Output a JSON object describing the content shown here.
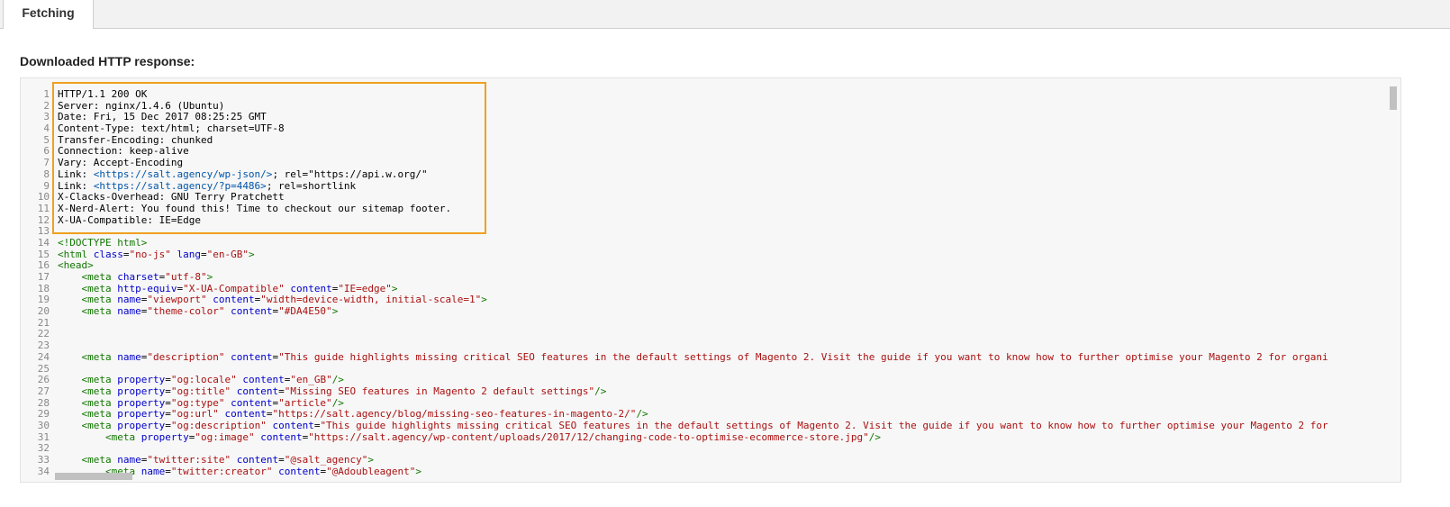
{
  "tabs": [
    {
      "label": "Fetching",
      "active": true
    }
  ],
  "section": {
    "heading": "Downloaded HTTP response:"
  },
  "colors": {
    "highlight_border": "#f0a020",
    "tag": "#117700",
    "attribute": "#0000cc",
    "string": "#aa1111",
    "link": "#0055aa"
  },
  "code_lines": [
    {
      "n": "1",
      "segments": [
        {
          "t": "HTTP/1.1 200 OK",
          "c": ""
        }
      ]
    },
    {
      "n": "2",
      "segments": [
        {
          "t": "Server: nginx/1.4.6 (Ubuntu)",
          "c": ""
        }
      ]
    },
    {
      "n": "3",
      "segments": [
        {
          "t": "Date: Fri, 15 Dec 2017 08:25:25 GMT",
          "c": ""
        }
      ]
    },
    {
      "n": "4",
      "segments": [
        {
          "t": "Content-Type: text/html; charset=UTF-8",
          "c": ""
        }
      ]
    },
    {
      "n": "5",
      "segments": [
        {
          "t": "Transfer-Encoding: chunked",
          "c": ""
        }
      ]
    },
    {
      "n": "6",
      "segments": [
        {
          "t": "Connection: keep-alive",
          "c": ""
        }
      ]
    },
    {
      "n": "7",
      "segments": [
        {
          "t": "Vary: Accept-Encoding",
          "c": ""
        }
      ]
    },
    {
      "n": "8",
      "segments": [
        {
          "t": "Link: ",
          "c": ""
        },
        {
          "t": "<https://salt.agency/wp-json/>",
          "c": "link"
        },
        {
          "t": "; rel=\"https://api.w.org/\"",
          "c": ""
        }
      ]
    },
    {
      "n": "9",
      "segments": [
        {
          "t": "Link: ",
          "c": ""
        },
        {
          "t": "<https://salt.agency/?p=4486>",
          "c": "link"
        },
        {
          "t": "; rel=shortlink",
          "c": ""
        }
      ]
    },
    {
      "n": "10",
      "segments": [
        {
          "t": "X-Clacks-Overhead: GNU Terry Pratchett",
          "c": ""
        }
      ]
    },
    {
      "n": "11",
      "segments": [
        {
          "t": "X-Nerd-Alert: You found this! Time to checkout our sitemap footer.",
          "c": ""
        }
      ]
    },
    {
      "n": "12",
      "segments": [
        {
          "t": "X-UA-Compatible: IE=Edge",
          "c": ""
        }
      ]
    },
    {
      "n": "13",
      "segments": []
    },
    {
      "n": "14",
      "segments": [
        {
          "t": "<!DOCTYPE html>",
          "c": "tag"
        }
      ]
    },
    {
      "n": "15",
      "segments": [
        {
          "t": "<html ",
          "c": "tag"
        },
        {
          "t": "class",
          "c": "attr"
        },
        {
          "t": "=",
          "c": ""
        },
        {
          "t": "\"no-js\"",
          "c": "val"
        },
        {
          "t": " ",
          "c": ""
        },
        {
          "t": "lang",
          "c": "attr"
        },
        {
          "t": "=",
          "c": ""
        },
        {
          "t": "\"en-GB\"",
          "c": "val"
        },
        {
          "t": ">",
          "c": "tag"
        }
      ]
    },
    {
      "n": "16",
      "segments": [
        {
          "t": "<head>",
          "c": "tag"
        }
      ]
    },
    {
      "n": "17",
      "segments": [
        {
          "t": "    ",
          "c": ""
        },
        {
          "t": "<meta ",
          "c": "tag"
        },
        {
          "t": "charset",
          "c": "attr"
        },
        {
          "t": "=",
          "c": ""
        },
        {
          "t": "\"utf-8\"",
          "c": "val"
        },
        {
          "t": ">",
          "c": "tag"
        }
      ]
    },
    {
      "n": "18",
      "segments": [
        {
          "t": "    ",
          "c": ""
        },
        {
          "t": "<meta ",
          "c": "tag"
        },
        {
          "t": "http-equiv",
          "c": "attr"
        },
        {
          "t": "=",
          "c": ""
        },
        {
          "t": "\"X-UA-Compatible\"",
          "c": "val"
        },
        {
          "t": " ",
          "c": ""
        },
        {
          "t": "content",
          "c": "attr"
        },
        {
          "t": "=",
          "c": ""
        },
        {
          "t": "\"IE=edge\"",
          "c": "val"
        },
        {
          "t": ">",
          "c": "tag"
        }
      ]
    },
    {
      "n": "19",
      "segments": [
        {
          "t": "    ",
          "c": ""
        },
        {
          "t": "<meta ",
          "c": "tag"
        },
        {
          "t": "name",
          "c": "attr"
        },
        {
          "t": "=",
          "c": ""
        },
        {
          "t": "\"viewport\"",
          "c": "val"
        },
        {
          "t": " ",
          "c": ""
        },
        {
          "t": "content",
          "c": "attr"
        },
        {
          "t": "=",
          "c": ""
        },
        {
          "t": "\"width=device-width, initial-scale=1\"",
          "c": "val"
        },
        {
          "t": ">",
          "c": "tag"
        }
      ]
    },
    {
      "n": "20",
      "segments": [
        {
          "t": "    ",
          "c": ""
        },
        {
          "t": "<meta ",
          "c": "tag"
        },
        {
          "t": "name",
          "c": "attr"
        },
        {
          "t": "=",
          "c": ""
        },
        {
          "t": "\"theme-color\"",
          "c": "val"
        },
        {
          "t": " ",
          "c": ""
        },
        {
          "t": "content",
          "c": "attr"
        },
        {
          "t": "=",
          "c": ""
        },
        {
          "t": "\"#DA4E50\"",
          "c": "val"
        },
        {
          "t": ">",
          "c": "tag"
        }
      ]
    },
    {
      "n": "21",
      "segments": []
    },
    {
      "n": "22",
      "segments": []
    },
    {
      "n": "23",
      "segments": []
    },
    {
      "n": "24",
      "segments": [
        {
          "t": "    ",
          "c": ""
        },
        {
          "t": "<meta ",
          "c": "tag"
        },
        {
          "t": "name",
          "c": "attr"
        },
        {
          "t": "=",
          "c": ""
        },
        {
          "t": "\"description\"",
          "c": "val"
        },
        {
          "t": " ",
          "c": ""
        },
        {
          "t": "content",
          "c": "attr"
        },
        {
          "t": "=",
          "c": ""
        },
        {
          "t": "\"This guide highlights missing critical SEO features in the default settings of Magento 2. Visit the guide if you want to know how to further optimise your Magento 2 for organi",
          "c": "val"
        }
      ]
    },
    {
      "n": "25",
      "segments": []
    },
    {
      "n": "26",
      "segments": [
        {
          "t": "    ",
          "c": ""
        },
        {
          "t": "<meta ",
          "c": "tag"
        },
        {
          "t": "property",
          "c": "attr"
        },
        {
          "t": "=",
          "c": ""
        },
        {
          "t": "\"og:locale\"",
          "c": "val"
        },
        {
          "t": " ",
          "c": ""
        },
        {
          "t": "content",
          "c": "attr"
        },
        {
          "t": "=",
          "c": ""
        },
        {
          "t": "\"en_GB\"",
          "c": "val"
        },
        {
          "t": "/>",
          "c": "tag"
        }
      ]
    },
    {
      "n": "27",
      "segments": [
        {
          "t": "    ",
          "c": ""
        },
        {
          "t": "<meta ",
          "c": "tag"
        },
        {
          "t": "property",
          "c": "attr"
        },
        {
          "t": "=",
          "c": ""
        },
        {
          "t": "\"og:title\"",
          "c": "val"
        },
        {
          "t": " ",
          "c": ""
        },
        {
          "t": "content",
          "c": "attr"
        },
        {
          "t": "=",
          "c": ""
        },
        {
          "t": "\"Missing SEO features in Magento 2 default settings\"",
          "c": "val"
        },
        {
          "t": "/>",
          "c": "tag"
        }
      ]
    },
    {
      "n": "28",
      "segments": [
        {
          "t": "    ",
          "c": ""
        },
        {
          "t": "<meta ",
          "c": "tag"
        },
        {
          "t": "property",
          "c": "attr"
        },
        {
          "t": "=",
          "c": ""
        },
        {
          "t": "\"og:type\"",
          "c": "val"
        },
        {
          "t": " ",
          "c": ""
        },
        {
          "t": "content",
          "c": "attr"
        },
        {
          "t": "=",
          "c": ""
        },
        {
          "t": "\"article\"",
          "c": "val"
        },
        {
          "t": "/>",
          "c": "tag"
        }
      ]
    },
    {
      "n": "29",
      "segments": [
        {
          "t": "    ",
          "c": ""
        },
        {
          "t": "<meta ",
          "c": "tag"
        },
        {
          "t": "property",
          "c": "attr"
        },
        {
          "t": "=",
          "c": ""
        },
        {
          "t": "\"og:url\"",
          "c": "val"
        },
        {
          "t": " ",
          "c": ""
        },
        {
          "t": "content",
          "c": "attr"
        },
        {
          "t": "=",
          "c": ""
        },
        {
          "t": "\"https://salt.agency/blog/missing-seo-features-in-magento-2/\"",
          "c": "val"
        },
        {
          "t": "/>",
          "c": "tag"
        }
      ]
    },
    {
      "n": "30",
      "segments": [
        {
          "t": "    ",
          "c": ""
        },
        {
          "t": "<meta ",
          "c": "tag"
        },
        {
          "t": "property",
          "c": "attr"
        },
        {
          "t": "=",
          "c": ""
        },
        {
          "t": "\"og:description\"",
          "c": "val"
        },
        {
          "t": " ",
          "c": ""
        },
        {
          "t": "content",
          "c": "attr"
        },
        {
          "t": "=",
          "c": ""
        },
        {
          "t": "\"This guide highlights missing critical SEO features in the default settings of Magento 2. Visit the guide if you want to know how to further optimise your Magento 2 for",
          "c": "val"
        }
      ]
    },
    {
      "n": "31",
      "segments": [
        {
          "t": "        ",
          "c": ""
        },
        {
          "t": "<meta ",
          "c": "tag"
        },
        {
          "t": "property",
          "c": "attr"
        },
        {
          "t": "=",
          "c": ""
        },
        {
          "t": "\"og:image\"",
          "c": "val"
        },
        {
          "t": " ",
          "c": ""
        },
        {
          "t": "content",
          "c": "attr"
        },
        {
          "t": "=",
          "c": ""
        },
        {
          "t": "\"https://salt.agency/wp-content/uploads/2017/12/changing-code-to-optimise-ecommerce-store.jpg\"",
          "c": "val"
        },
        {
          "t": "/>",
          "c": "tag"
        }
      ]
    },
    {
      "n": "32",
      "segments": []
    },
    {
      "n": "33",
      "segments": [
        {
          "t": "    ",
          "c": ""
        },
        {
          "t": "<meta ",
          "c": "tag"
        },
        {
          "t": "name",
          "c": "attr"
        },
        {
          "t": "=",
          "c": ""
        },
        {
          "t": "\"twitter:site\"",
          "c": "val"
        },
        {
          "t": " ",
          "c": ""
        },
        {
          "t": "content",
          "c": "attr"
        },
        {
          "t": "=",
          "c": ""
        },
        {
          "t": "\"@salt_agency\"",
          "c": "val"
        },
        {
          "t": ">",
          "c": "tag"
        }
      ]
    },
    {
      "n": "34",
      "segments": [
        {
          "t": "        ",
          "c": ""
        },
        {
          "t": "<meta ",
          "c": "tag"
        },
        {
          "t": "name",
          "c": "attr"
        },
        {
          "t": "=",
          "c": ""
        },
        {
          "t": "\"twitter:creator\"",
          "c": "val"
        },
        {
          "t": " ",
          "c": ""
        },
        {
          "t": "content",
          "c": "attr"
        },
        {
          "t": "=",
          "c": ""
        },
        {
          "t": "\"@Adoubleagent\"",
          "c": "val"
        },
        {
          "t": ">",
          "c": "tag"
        }
      ]
    }
  ]
}
